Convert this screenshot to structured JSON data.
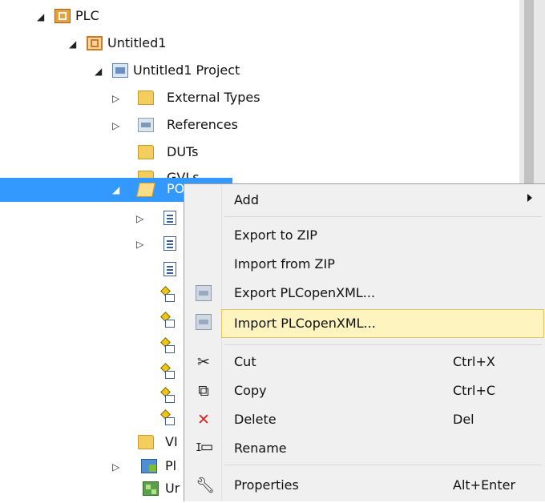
{
  "tree": {
    "nodes": [
      {
        "label": "PLC",
        "expanded": true,
        "icon": "plc-icon"
      },
      {
        "label": "Untitled1",
        "expanded": true,
        "icon": "plc-project-icon"
      },
      {
        "label": "Untitled1 Project",
        "expanded": true,
        "icon": "project-icon"
      },
      {
        "label": "External Types",
        "expanded": false,
        "icon": "folder-icon"
      },
      {
        "label": "References",
        "expanded": false,
        "icon": "references-icon"
      },
      {
        "label": "DUTs",
        "icon": "folder-icon"
      },
      {
        "label": "GVLs",
        "icon": "folder-icon"
      },
      {
        "label": "PO",
        "expanded": true,
        "selected": true,
        "icon": "folder-open-icon"
      },
      {
        "label": "",
        "expanded": false,
        "icon": "pou-document-icon"
      },
      {
        "label": "",
        "expanded": false,
        "icon": "pou-document-icon"
      },
      {
        "label": "",
        "icon": "pou-document-icon"
      },
      {
        "label": "",
        "icon": "action-icon"
      },
      {
        "label": "",
        "icon": "action-icon"
      },
      {
        "label": "",
        "icon": "action-icon"
      },
      {
        "label": "",
        "icon": "action-icon"
      },
      {
        "label": "",
        "icon": "action-icon"
      },
      {
        "label": "",
        "icon": "action-icon"
      },
      {
        "label": "VI",
        "icon": "folder-icon"
      },
      {
        "label": "Pl",
        "expanded": false,
        "icon": "platform-icon"
      },
      {
        "label": "Ur",
        "icon": "task-icon"
      }
    ]
  },
  "context_menu": {
    "items": [
      {
        "label": "Add",
        "submenu": true
      },
      {
        "label": "Export to ZIP"
      },
      {
        "label": "Import from ZIP"
      },
      {
        "label": "Export PLCopenXML...",
        "icon": "plcopenxml-export-icon"
      },
      {
        "label": "Import PLCopenXML...",
        "icon": "plcopenxml-import-icon",
        "hovered": true
      },
      {
        "label": "Cut",
        "shortcut": "Ctrl+X",
        "icon": "scissors-icon"
      },
      {
        "label": "Copy",
        "shortcut": "Ctrl+C",
        "icon": "copy-icon"
      },
      {
        "label": "Delete",
        "shortcut": "Del",
        "icon": "delete-icon"
      },
      {
        "label": "Rename",
        "icon": "rename-icon"
      },
      {
        "label": "Properties",
        "shortcut": "Alt+Enter",
        "icon": "wrench-icon"
      }
    ],
    "hover_color": "#fdf4bf",
    "delete_icon_color": "#d9251d"
  },
  "colors": {
    "selection": "#3399ff",
    "menu_background": "#f0f0f0"
  }
}
